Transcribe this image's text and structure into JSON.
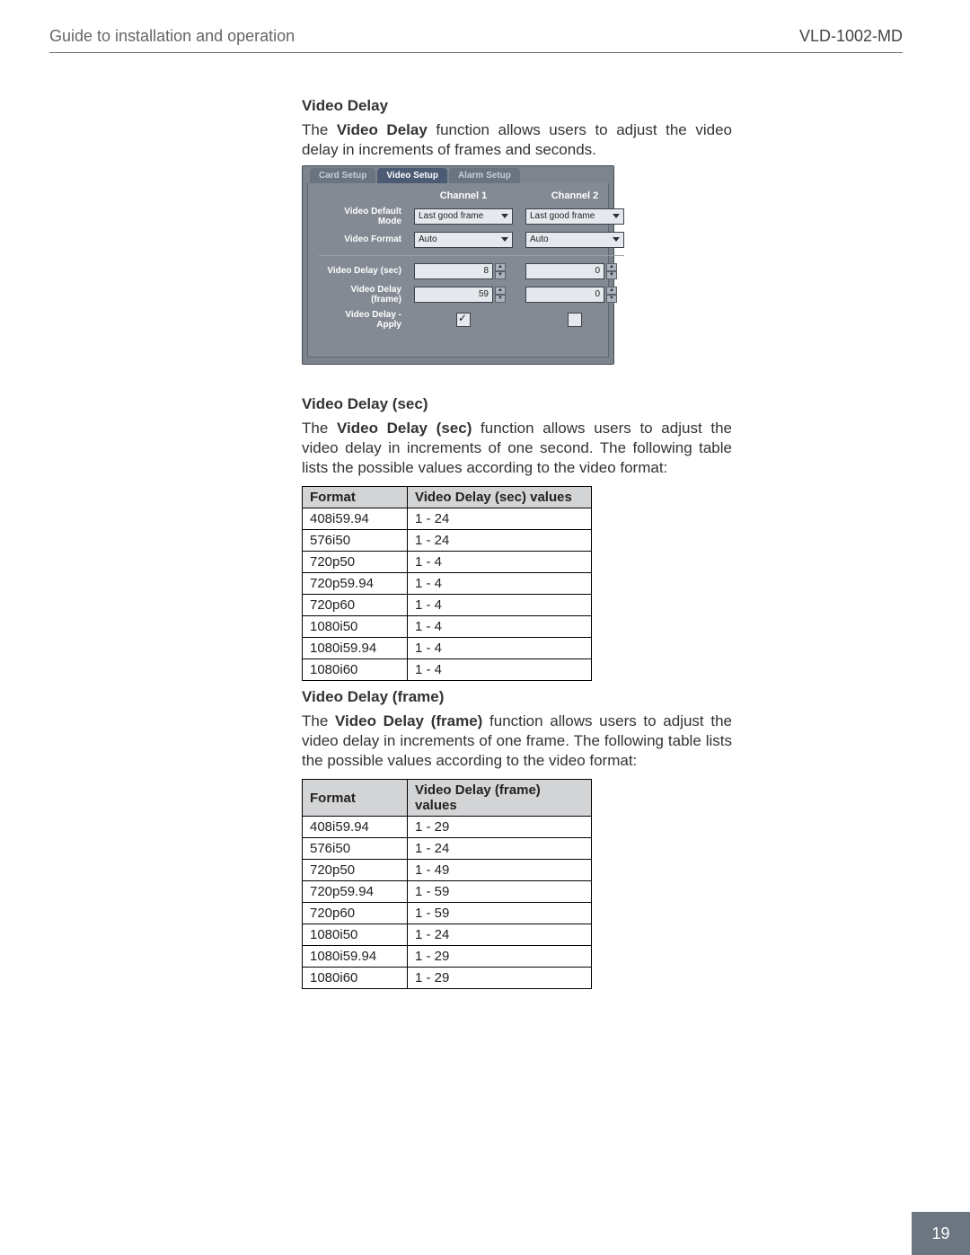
{
  "header": {
    "title": "Guide to installation and operation",
    "model": "VLD-1002-MD"
  },
  "page_number": "19",
  "section1": {
    "heading": "Video Delay",
    "p_before_bold": "The ",
    "p_bold": "Video Delay",
    "p_after_bold": " function allows users to adjust the video delay in increments of frames and seconds."
  },
  "panel": {
    "tabs": {
      "card": "Card Setup",
      "video": "Video Setup",
      "alarm": "Alarm Setup"
    },
    "ch1": "Channel 1",
    "ch2": "Channel 2",
    "rows": {
      "default_mode": "Video Default Mode",
      "format": "Video Format",
      "delay_sec": "Video Delay (sec)",
      "delay_frame": "Video Delay (frame)",
      "delay_apply": "Video Delay - Apply"
    },
    "ch1_vals": {
      "default_mode": "Last good frame",
      "format": "Auto",
      "delay_sec": "8",
      "delay_frame": "59",
      "apply_checked": true
    },
    "ch2_vals": {
      "default_mode": "Last good frame",
      "format": "Auto",
      "delay_sec": "0",
      "delay_frame": "0",
      "apply_checked": false
    }
  },
  "section2": {
    "heading": "Video Delay (sec)",
    "p_before_bold": "The ",
    "p_bold": "Video Delay (sec)",
    "p_after_bold": " function allows users to adjust the video delay in increments of one second. The following table lists the possible values according to the video format:",
    "table": {
      "head": {
        "c1": "Format",
        "c2": "Video Delay (sec) values"
      },
      "rows": [
        {
          "c1": "408i59.94",
          "c2": "1 - 24"
        },
        {
          "c1": "576i50",
          "c2": "1 - 24"
        },
        {
          "c1": "720p50",
          "c2": "1 - 4"
        },
        {
          "c1": "720p59.94",
          "c2": "1 - 4"
        },
        {
          "c1": "720p60",
          "c2": "1 - 4"
        },
        {
          "c1": "1080i50",
          "c2": "1 - 4"
        },
        {
          "c1": "1080i59.94",
          "c2": "1 - 4"
        },
        {
          "c1": "1080i60",
          "c2": "1 - 4"
        }
      ]
    }
  },
  "section3": {
    "heading": "Video Delay (frame)",
    "p_before_bold": "The ",
    "p_bold": "Video Delay (frame)",
    "p_after_bold": " function allows users to adjust the video delay in increments of one frame. The following table lists the possible values according to the video format:",
    "table": {
      "head": {
        "c1": "Format",
        "c2": "Video Delay (frame) values"
      },
      "rows": [
        {
          "c1": "408i59.94",
          "c2": "1 - 29"
        },
        {
          "c1": "576i50",
          "c2": "1 - 24"
        },
        {
          "c1": "720p50",
          "c2": "1 - 49"
        },
        {
          "c1": "720p59.94",
          "c2": "1 - 59"
        },
        {
          "c1": "720p60",
          "c2": "1 - 59"
        },
        {
          "c1": "1080i50",
          "c2": "1 - 24"
        },
        {
          "c1": "1080i59.94",
          "c2": "1 - 29"
        },
        {
          "c1": "1080i60",
          "c2": "1 - 29"
        }
      ]
    }
  }
}
